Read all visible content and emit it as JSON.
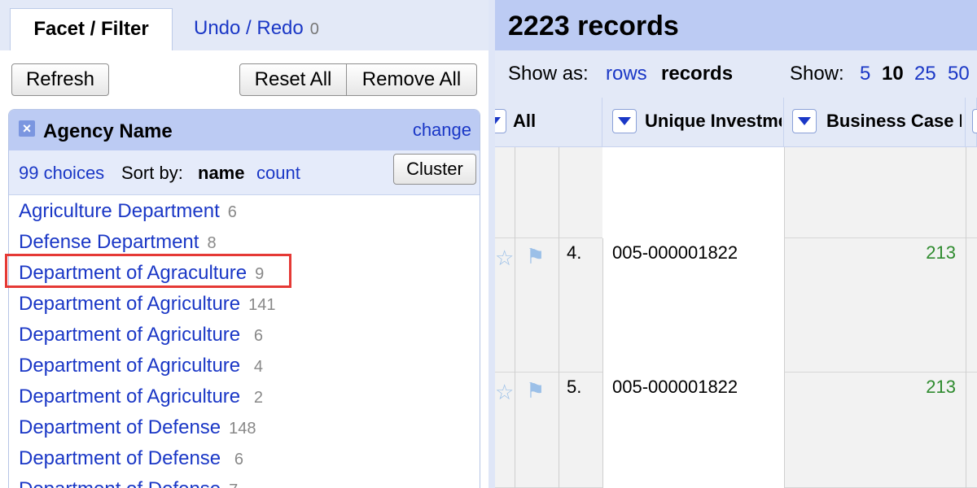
{
  "left_panel": {
    "tabs": {
      "facet_label": "Facet / Filter",
      "undo_label": "Undo / Redo",
      "undo_count": "0"
    },
    "buttons": {
      "refresh": "Refresh",
      "reset_all": "Reset All",
      "remove_all": "Remove All"
    },
    "facet": {
      "close": "×",
      "title": "Agency Name",
      "change": "change",
      "choices_link": "99 choices",
      "sort_by_label": "Sort by:",
      "sort_name": "name",
      "sort_count": "count",
      "cluster": "Cluster",
      "choices": [
        {
          "name": "Agriculture Department",
          "count": "6"
        },
        {
          "name": "Defense Department",
          "count": "8"
        },
        {
          "name": "Department of Agraculture",
          "count": "9"
        },
        {
          "name": "Department of Agriculture",
          "count": "141"
        },
        {
          "name": "Department of Agriculture ",
          "count": "6"
        },
        {
          "name": "Department of Agriculture ",
          "count": "4"
        },
        {
          "name": "Department of Agriculture ",
          "count": "2"
        },
        {
          "name": "Department of Defense",
          "count": "148"
        },
        {
          "name": "Department of Defense ",
          "count": "6"
        },
        {
          "name": "Department of Defense",
          "count": "7"
        }
      ]
    }
  },
  "right_panel": {
    "records_title": "2223 records",
    "show_as_label": "Show as:",
    "rows_link": "rows",
    "records_label": "records",
    "show_label": "Show:",
    "page_sizes": {
      "p5": "5",
      "p10": "10",
      "p25": "25",
      "p50": "50"
    },
    "columns": {
      "all": "All",
      "unique_investment": "Unique Investme",
      "business_case": "Business Case I"
    },
    "rows": [
      {
        "index": "",
        "unique_investment": "",
        "business_case": ""
      },
      {
        "index": "4.",
        "unique_investment": "005-000001822",
        "business_case": "213"
      },
      {
        "index": "5.",
        "unique_investment": "005-000001822",
        "business_case": "213"
      }
    ]
  }
}
